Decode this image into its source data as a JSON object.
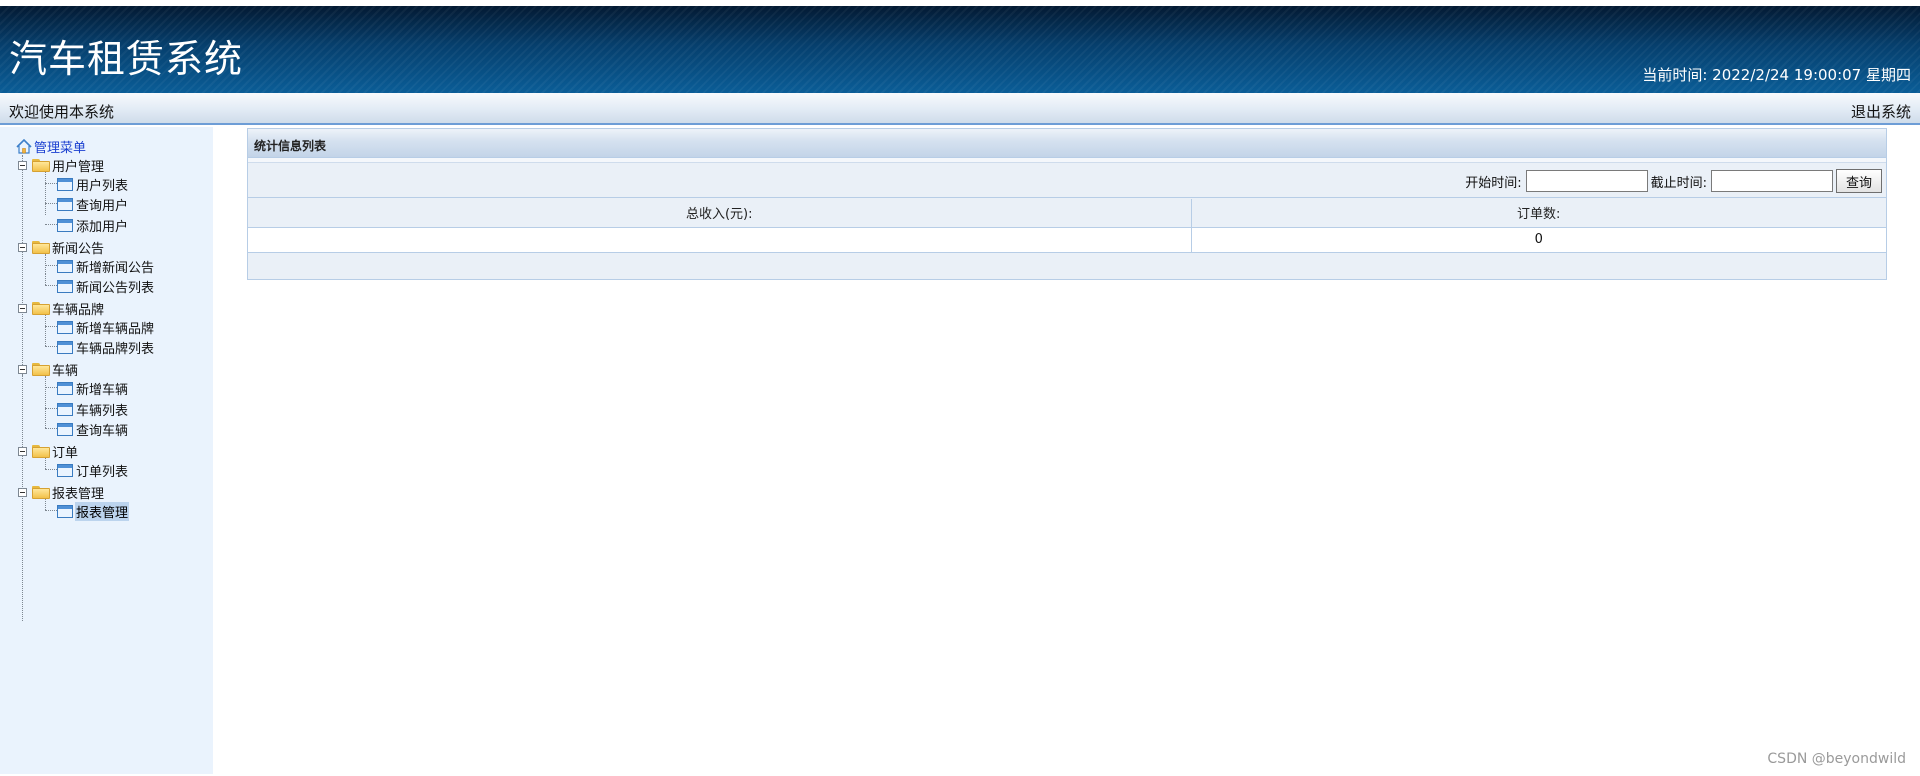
{
  "header": {
    "app_title": "汽车租赁系统",
    "clock_label": "当前时间:",
    "clock_value": "2022/2/24 19:00:07 星期四"
  },
  "welcome_bar": {
    "welcome_text": "欢迎使用本系统",
    "logout_label": "退出系统"
  },
  "sidebar": {
    "root_label": "管理菜单",
    "groups": [
      {
        "label": "用户管理",
        "items": [
          "用户列表",
          "查询用户",
          "添加用户"
        ]
      },
      {
        "label": "新闻公告",
        "items": [
          "新增新闻公告",
          "新闻公告列表"
        ]
      },
      {
        "label": "车辆品牌",
        "items": [
          "新增车辆品牌",
          "车辆品牌列表"
        ]
      },
      {
        "label": "车辆",
        "items": [
          "新增车辆",
          "车辆列表",
          "查询车辆"
        ]
      },
      {
        "label": "订单",
        "items": [
          "订单列表"
        ]
      },
      {
        "label": "报表管理",
        "items": [
          "报表管理"
        ]
      }
    ],
    "selected_item": "报表管理"
  },
  "main": {
    "panel_title": "统计信息列表",
    "search": {
      "start_label": "开始时间:",
      "start_value": "",
      "end_label": "截止时间:",
      "end_value": "",
      "query_button": "查询"
    },
    "table": {
      "headers": [
        "总收入(元):",
        "订单数:"
      ],
      "row": [
        "",
        "0"
      ]
    }
  },
  "watermark": "CSDN @beyondwild",
  "colors": {
    "header_dark": "#031a33",
    "header_light": "#0a5d97",
    "sidebar_bg": "#eaf3fd",
    "panel_border": "#b7cde6",
    "link_blue": "#1a3fd0"
  }
}
